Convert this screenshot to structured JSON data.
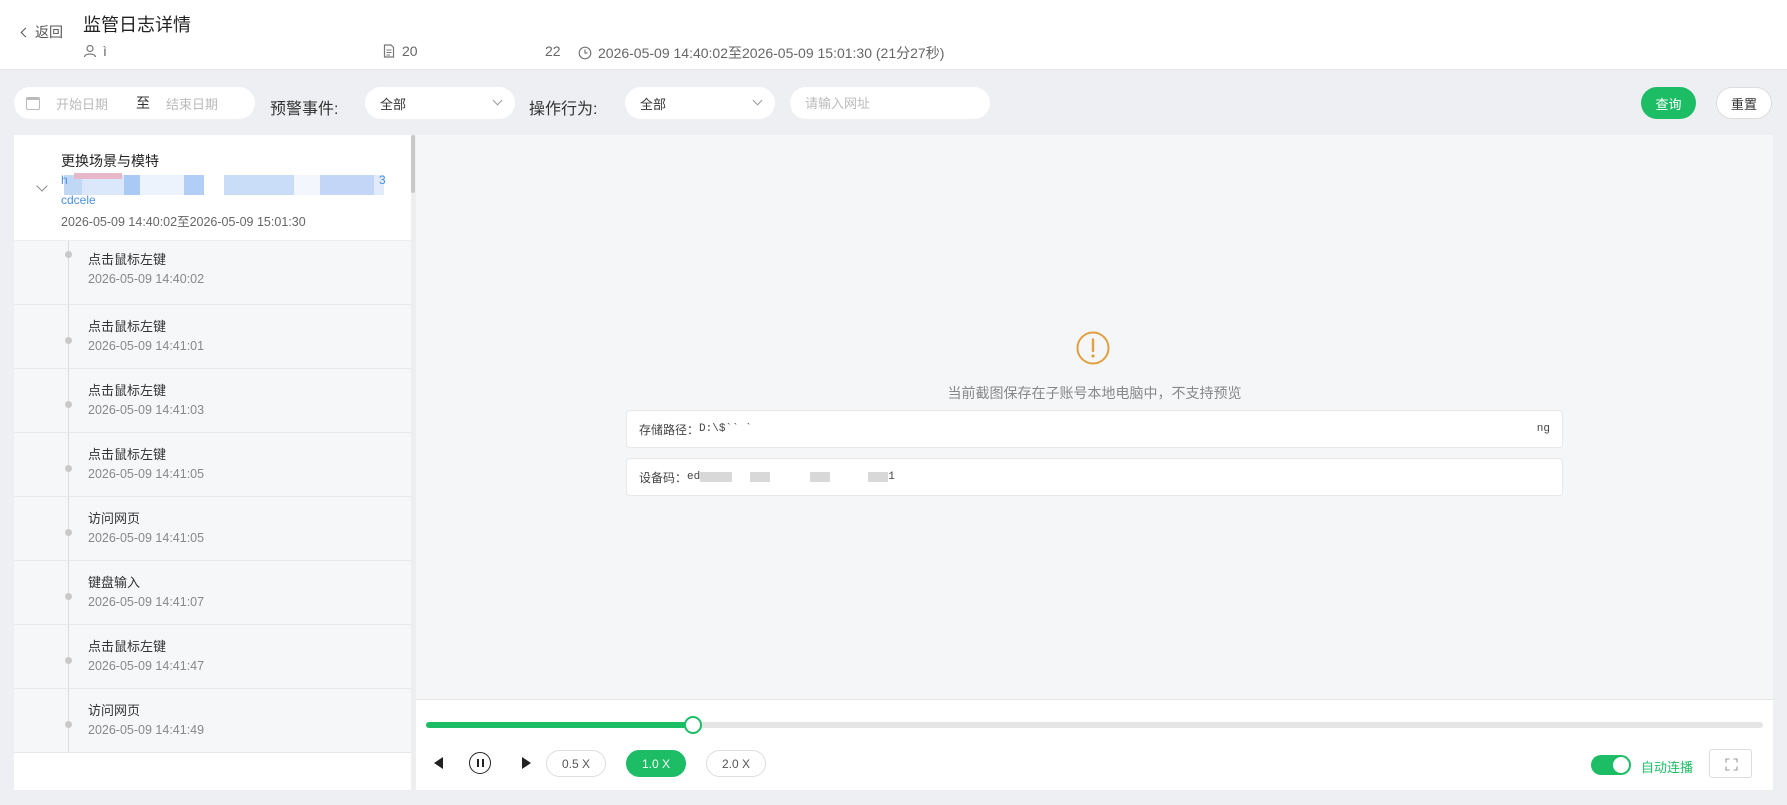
{
  "header": {
    "back_label": "返回",
    "title": "监管日志详情",
    "user": "ì",
    "doc": "20",
    "doc_suffix": "22",
    "time_range": "2026-05-09 14:40:02至2026-05-09 15:01:30 (21分27秒)"
  },
  "filters": {
    "start_placeholder": "开始日期",
    "range_sep": "至",
    "end_placeholder": "结束日期",
    "warning_event_label": "预警事件:",
    "warning_event_value": "全部",
    "action_label": "操作行为:",
    "action_value": "全部",
    "url_placeholder": "请输入网址",
    "query_label": "查询",
    "reset_label": "重置"
  },
  "session": {
    "title": "更换场景与模特",
    "url_prefix": "h",
    "url_suffix": "3",
    "url_line2": "cdcele",
    "range": "2026-05-09 14:40:02至2026-05-09 15:01:30"
  },
  "events": [
    {
      "name": "点击鼠标左键",
      "time": "2026-05-09 14:40:02"
    },
    {
      "name": "点击鼠标左键",
      "time": "2026-05-09 14:41:01"
    },
    {
      "name": "点击鼠标左键",
      "time": "2026-05-09 14:41:03"
    },
    {
      "name": "点击鼠标左键",
      "time": "2026-05-09 14:41:05"
    },
    {
      "name": "访问网页",
      "time": "2026-05-09 14:41:05"
    },
    {
      "name": "键盘输入",
      "time": "2026-05-09 14:41:07"
    },
    {
      "name": "点击鼠标左键",
      "time": "2026-05-09 14:41:47"
    },
    {
      "name": "访问网页",
      "time": "2026-05-09 14:41:49"
    }
  ],
  "preview": {
    "notice": "当前截图保存在子账号本地电脑中，不支持预览",
    "path_label": "存储路径：",
    "path_value": "D:\\$`` `",
    "path_end": "ng",
    "device_label": "设备码：",
    "device_value": "ed",
    "device_end": "1"
  },
  "player": {
    "progress": 0.2,
    "speeds": [
      "0.5 X",
      "1.0 X",
      "2.0 X"
    ],
    "active_speed": "1.0 X",
    "auto_label": "自动连播",
    "auto_on": true
  },
  "colors": {
    "accent": "#1dbd66",
    "warning": "#e0a040",
    "link": "#4a90e2"
  }
}
